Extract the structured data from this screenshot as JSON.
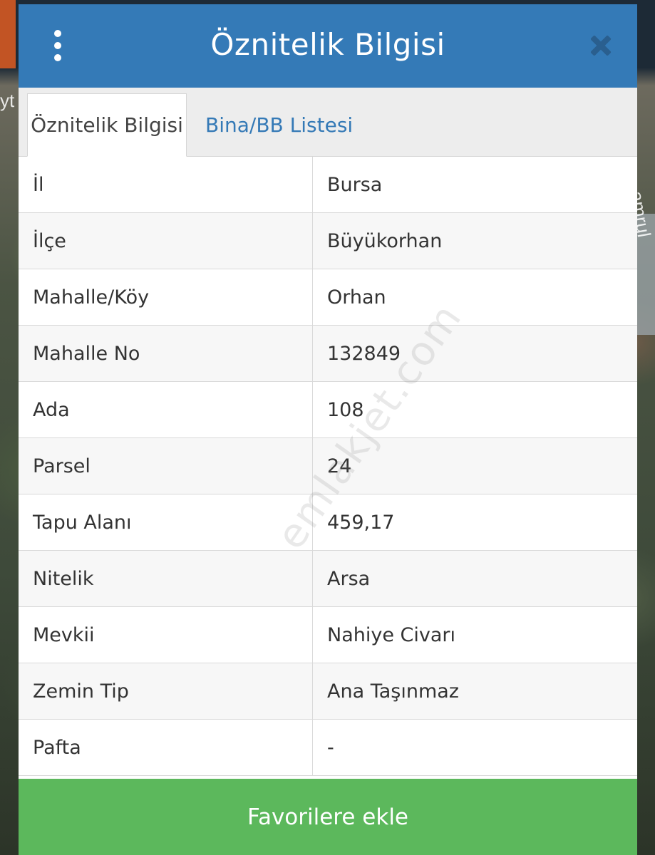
{
  "map": {
    "road_label_left": "yt",
    "road_label_right": "amrul"
  },
  "modal": {
    "title": "Öznitelik Bilgisi",
    "menu_icon": "kebab-menu-icon",
    "close_icon": "close-icon"
  },
  "tabs": [
    {
      "label": "Öznitelik Bilgisi",
      "active": true
    },
    {
      "label": "Bina/BB Listesi",
      "active": false
    }
  ],
  "rows": [
    {
      "key": "İl",
      "value": "Bursa"
    },
    {
      "key": "İlçe",
      "value": "Büyükorhan"
    },
    {
      "key": "Mahalle/Köy",
      "value": "Orhan"
    },
    {
      "key": "Mahalle No",
      "value": "132849"
    },
    {
      "key": "Ada",
      "value": "108"
    },
    {
      "key": "Parsel",
      "value": "24"
    },
    {
      "key": "Tapu Alanı",
      "value": "459,17"
    },
    {
      "key": "Nitelik",
      "value": "Arsa"
    },
    {
      "key": "Mevkii",
      "value": "Nahiye Civarı"
    },
    {
      "key": "Zemin Tip",
      "value": "Ana Taşınmaz"
    },
    {
      "key": "Pafta",
      "value": "-"
    }
  ],
  "watermark": "emlakjet.com",
  "footer": {
    "button_label": "Favorilere ekle"
  },
  "colors": {
    "header": "#347ab7",
    "tab_link": "#3479b6",
    "button": "#5cb85c"
  }
}
